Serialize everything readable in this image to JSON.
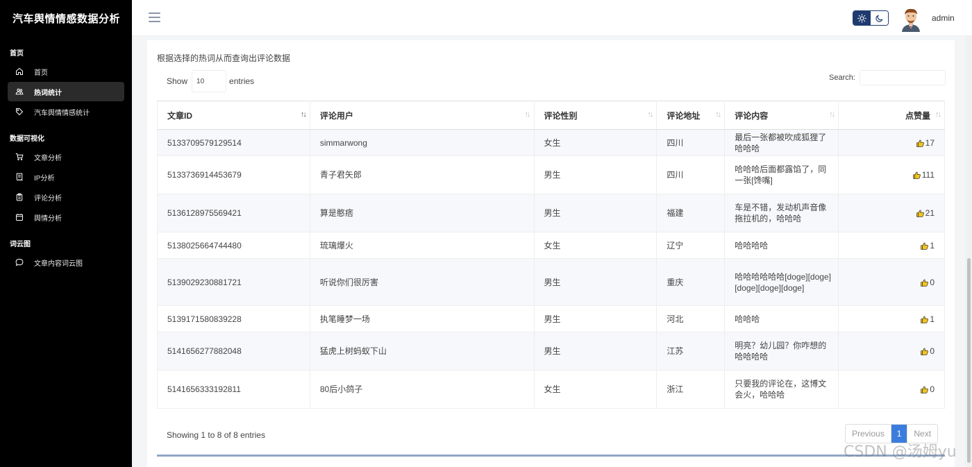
{
  "app": {
    "brand": "汽车舆情情感数据分析",
    "username": "admin"
  },
  "sidebar": {
    "sections": [
      {
        "title": "首页",
        "items": [
          {
            "label": "首页",
            "icon": "home-icon"
          },
          {
            "label": "热词统计",
            "icon": "users-icon",
            "active": true
          },
          {
            "label": "汽车舆情情感统计",
            "icon": "tag-icon"
          }
        ]
      },
      {
        "title": "数据可视化",
        "items": [
          {
            "label": "文章分析",
            "icon": "cart-icon"
          },
          {
            "label": "IP分析",
            "icon": "receipt-icon"
          },
          {
            "label": "评论分析",
            "icon": "clipboard-icon"
          },
          {
            "label": "舆情分析",
            "icon": "calendar-icon"
          }
        ]
      },
      {
        "title": "词云图",
        "items": [
          {
            "label": "文章内容词云图",
            "icon": "comment-icon"
          }
        ]
      }
    ]
  },
  "main": {
    "subtitle": "根据选择的热词从而查询出评论数据",
    "show_label": "Show",
    "entries_value": "10",
    "entries_label": "entries",
    "search_label": "Search:",
    "columns": [
      "文章ID",
      "评论用户",
      "评论性别",
      "评论地址",
      "评论内容",
      "点赞量"
    ],
    "rows": [
      {
        "id": "5133709579129514",
        "user": "simmarwong",
        "gender": "女生",
        "address": "四川",
        "content": "最后一张都被吹成狐狸了哈哈哈",
        "likes": "17"
      },
      {
        "id": "5133736914453679",
        "user": "青子君矢郎",
        "gender": "男生",
        "address": "四川",
        "content": "哈哈哈后面都露馅了，同一张[馋嘴]",
        "likes": "111"
      },
      {
        "id": "5136128975569421",
        "user": "算是憨痞",
        "gender": "男生",
        "address": "福建",
        "content": "车是不错，发动机声音像拖拉机的，哈哈哈",
        "likes": "21"
      },
      {
        "id": "5138025664744480",
        "user": "琉璃爆火",
        "gender": "女生",
        "address": "辽宁",
        "content": "哈哈哈哈",
        "likes": "1"
      },
      {
        "id": "5139029230881721",
        "user": "听说你们很厉害",
        "gender": "男生",
        "address": "重庆",
        "content": "哈哈哈哈哈哈[doge][doge][doge][doge][doge]",
        "likes": "0"
      },
      {
        "id": "5139171580839228",
        "user": "执笔睡梦一场",
        "gender": "男生",
        "address": "河北",
        "content": "哈哈哈",
        "likes": "1"
      },
      {
        "id": "5141656277882048",
        "user": "猛虎上树蚂蚁下山",
        "gender": "男生",
        "address": "江苏",
        "content": "明亮？幼儿园？你咋想的哈哈哈哈",
        "likes": "0"
      },
      {
        "id": "5141656333192811",
        "user": "80后小鸽子",
        "gender": "女生",
        "address": "浙江",
        "content": "只要我的评论在，这博文会火，哈哈哈",
        "likes": "0"
      }
    ],
    "showing_text": "Showing 1 to 8 of 8 entries",
    "pager": {
      "prev": "Previous",
      "current": "1",
      "next": "Next"
    }
  },
  "watermark": "CSDN @汤姆yu",
  "colors": {
    "accent": "#3b7ddd",
    "sidebar_bg": "#000000",
    "theme_toggle": "#1f3a6e"
  }
}
